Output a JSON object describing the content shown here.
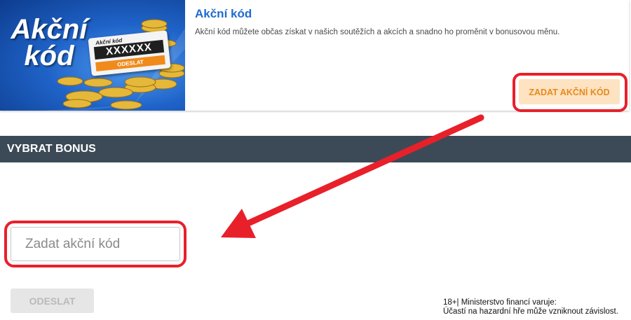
{
  "promo": {
    "banner": {
      "title_line1": "Akční",
      "title_line2": "kód",
      "ticket_label": "Akční kód",
      "ticket_code": "XXXXXX",
      "ticket_button": "ODESLAT"
    },
    "title": "Akční kód",
    "description": "Akční kód můžete občas získat v našich soutěžích a akcích a snadno ho proměnit v bonusovou měnu.",
    "button_label": "ZADAT AKČNÍ KÓD"
  },
  "section": {
    "title": "VYBRAT BONUS"
  },
  "code_input": {
    "placeholder": "Zadat akční kód",
    "value": ""
  },
  "submit_label": "ODESLAT",
  "warning": {
    "line1": "18+| Ministerstvo financí varuje:",
    "line2": "Účastí na hazardní hře může vzniknout závislost."
  },
  "colors": {
    "accent_blue": "#1f6bd0",
    "highlight_red": "#e8202a",
    "button_orange_text": "#e8891d",
    "button_orange_bg": "#fde3c1",
    "header_bg": "#3c4a57"
  }
}
